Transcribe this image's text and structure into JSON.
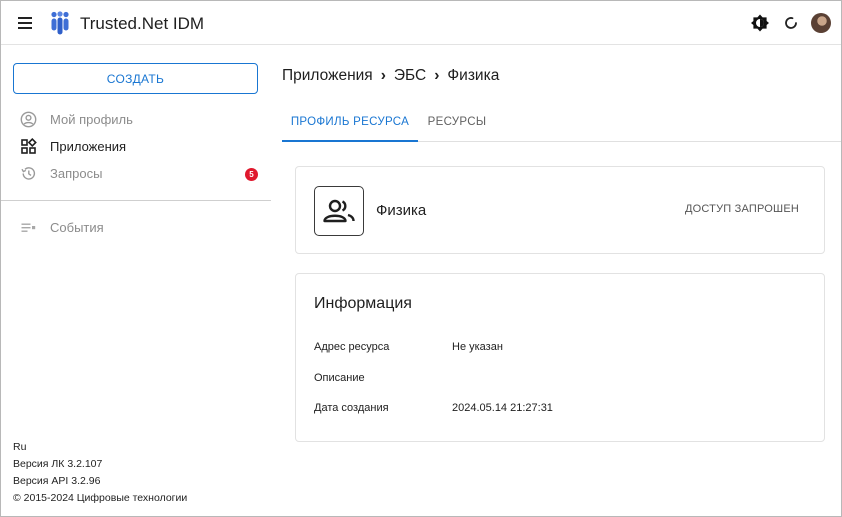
{
  "header": {
    "app_title": "Trusted.Net IDM",
    "icons": [
      "menu-icon",
      "logo",
      "theme-icon",
      "refresh-icon",
      "avatar"
    ]
  },
  "sidebar": {
    "create_label": "СОЗДАТЬ",
    "items": [
      {
        "label": "Мой профиль",
        "icon": "user-circle-icon",
        "active": false
      },
      {
        "label": "Приложения",
        "icon": "apps-grid-icon",
        "active": true
      },
      {
        "label": "Запросы",
        "icon": "history-icon",
        "active": false,
        "badge": "5"
      },
      {
        "label": "События",
        "icon": "events-list-icon",
        "active": false
      }
    ],
    "footer": {
      "language": "Ru",
      "version_lk": "Версия ЛК 3.2.107",
      "version_api": "Версия API 3.2.96",
      "copyright": "© 2015-2024 Цифровые технологии"
    }
  },
  "breadcrumb": {
    "items": [
      "Приложения",
      "ЭБС",
      "Физика"
    ],
    "separator": "›"
  },
  "tabs": [
    {
      "label": "ПРОФИЛЬ РЕСУРСА",
      "active": true
    },
    {
      "label": "РЕСУРСЫ",
      "active": false
    }
  ],
  "resource": {
    "name": "Физика",
    "status": "ДОСТУП ЗАПРОШЕН",
    "icon": "users-icon"
  },
  "info": {
    "title": "Информация",
    "rows": [
      {
        "label": "Адрес ресурса",
        "value": "Не указан"
      },
      {
        "label": "Описание",
        "value": ""
      },
      {
        "label": "Дата создания",
        "value": "2024.05.14 21:27:31"
      }
    ]
  },
  "colors": {
    "accent": "#1976d2",
    "badge": "#e0182d",
    "logo": "#3f6fd6"
  }
}
